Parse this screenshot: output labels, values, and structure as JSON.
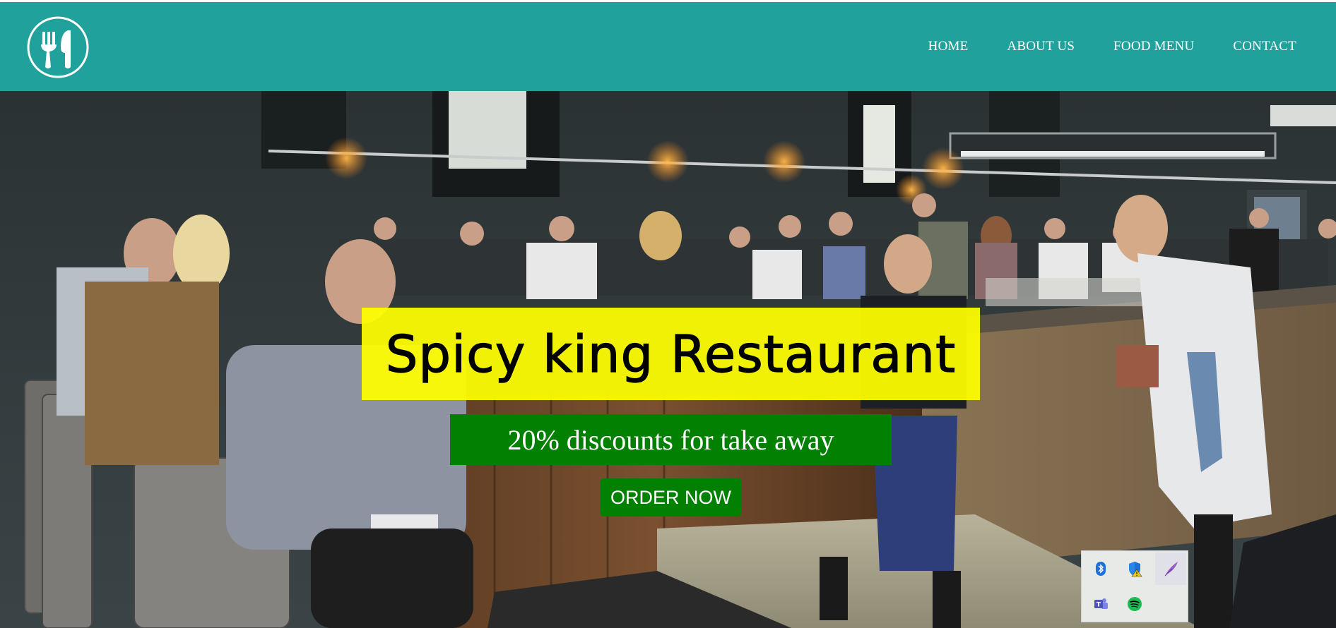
{
  "brand": {
    "logo_icon": "fork-knife-icon",
    "navbar_color": "#21a19c"
  },
  "nav": {
    "items": [
      {
        "label": "HOME"
      },
      {
        "label": "ABOUT US"
      },
      {
        "label": "FOOD MENU"
      },
      {
        "label": "CONTACT"
      }
    ]
  },
  "hero": {
    "title": "Spicy king Restaurant",
    "subtitle": "20% discounts for take away",
    "cta_label": "ORDER NOW",
    "title_bg": "#ffff00",
    "accent_green": "#018001"
  },
  "tray": {
    "icons": [
      {
        "name": "bluetooth-icon"
      },
      {
        "name": "security-warning-icon"
      },
      {
        "name": "feather-pen-icon"
      },
      {
        "name": "teams-icon"
      },
      {
        "name": "spotify-icon"
      }
    ]
  }
}
